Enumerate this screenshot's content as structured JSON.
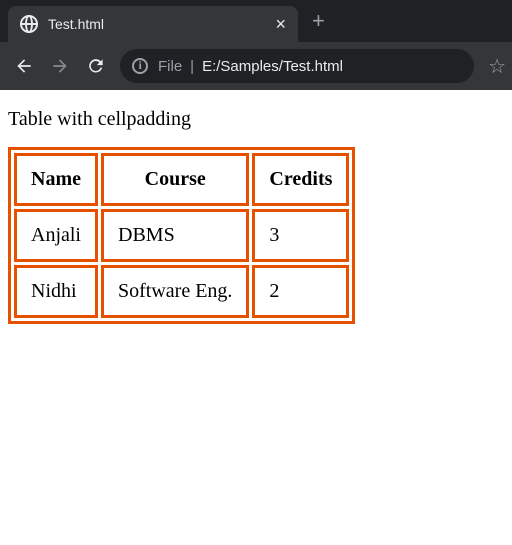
{
  "browser": {
    "tab_title": "Test.html",
    "url_scheme": "File",
    "url_path": "E:/Samples/Test.html"
  },
  "page": {
    "heading": "Table with cellpadding",
    "table": {
      "headers": [
        "Name",
        "Course",
        "Credits"
      ],
      "rows": [
        [
          "Anjali",
          "DBMS",
          "3"
        ],
        [
          "Nidhi",
          "Software Eng.",
          "2"
        ]
      ]
    }
  }
}
